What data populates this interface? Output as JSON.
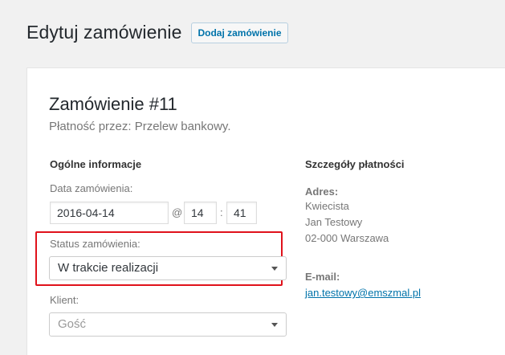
{
  "header": {
    "title": "Edytuj zamówienie",
    "add_button": "Dodaj zamówienie"
  },
  "order": {
    "title": "Zamówienie #11",
    "subtitle": "Płatność przez: Przelew bankowy."
  },
  "general": {
    "heading": "Ogólne informacje",
    "date_label": "Data zamówienia:",
    "date_value": "2016-04-14",
    "at_symbol": "@",
    "hour_value": "14",
    "colon": ":",
    "minute_value": "41",
    "status_label": "Status zamówienia:",
    "status_value": "W trakcie realizacji",
    "client_label": "Klient:",
    "client_value": "Gość"
  },
  "billing": {
    "heading": "Szczegóły płatności",
    "address_label": "Adres:",
    "address_lines": [
      "Kwiecista",
      "Jan Testowy",
      "02-000 Warszawa"
    ],
    "email_label": "E-mail:",
    "email_value": "jan.testowy@emszmal.pl"
  },
  "colors": {
    "highlight": "#e0121b",
    "link": "#0073aa"
  }
}
